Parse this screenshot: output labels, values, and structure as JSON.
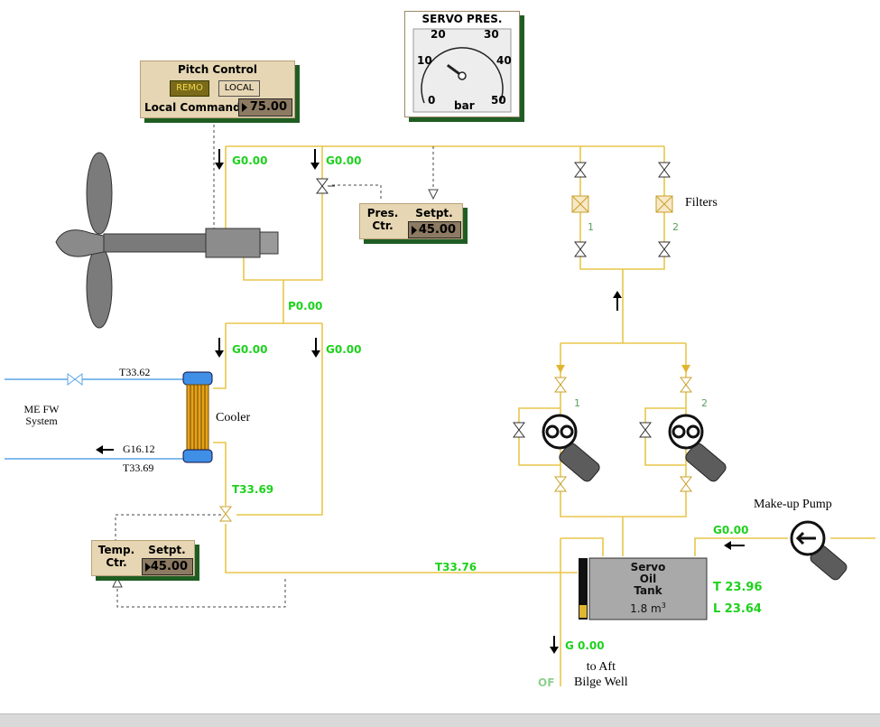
{
  "gauge": {
    "title": "SERVO PRES.",
    "ticks": [
      "0",
      "10",
      "20",
      "30",
      "40",
      "50"
    ],
    "unit": "bar"
  },
  "pitch_control": {
    "title": "Pitch Control",
    "remote_label": "REMO",
    "local_label": "LOCAL",
    "command_label": "Local Command",
    "command_value": "75.00"
  },
  "pres_ctr": {
    "label_line1": "Pres.",
    "label_line2": "Ctr.",
    "setpt_label": "Setpt.",
    "setpt_value": "45.00"
  },
  "temp_ctr": {
    "label_line1": "Temp.",
    "label_line2": "Ctr.",
    "setpt_label": "Setpt.",
    "setpt_value": "45.00"
  },
  "flows": {
    "g_top_left": "G0.00",
    "g_top_mid": "G0.00",
    "p_mid": "P0.00",
    "g_left_lower": "G0.00",
    "g_right_lower": "G0.00",
    "t_cooler_out": "T33.69",
    "t_return": "T33.76",
    "g_makeup": "G0.00",
    "g_drain": "G 0.00"
  },
  "labels": {
    "cooler": "Cooler",
    "filters": "Filters",
    "me_fw_line1": "ME FW",
    "me_fw_line2": "System",
    "fw_in": "T33.62",
    "fw_out_g": "G16.12",
    "fw_out_t": "T33.69",
    "makeup_pump": "Make-up Pump",
    "aft_line1": "to Aft",
    "aft_line2": "Bilge Well",
    "of": "OF",
    "filter1": "1",
    "filter2": "2",
    "pump1": "1",
    "pump2": "2"
  },
  "tank": {
    "line1": "Servo",
    "line2": "Oil",
    "line3": "Tank",
    "volume": "1.8 m",
    "volume_sup": "3",
    "temp": "T 23.96",
    "level": "L 23.64"
  },
  "colors": {
    "oil_line": "#e8c64a",
    "water_line": "#5aa6e6",
    "value_green": "#1ed11e",
    "panel": "#e6d6b3",
    "panel_shadow": "#1f5d23"
  },
  "gauge_reading": 15
}
